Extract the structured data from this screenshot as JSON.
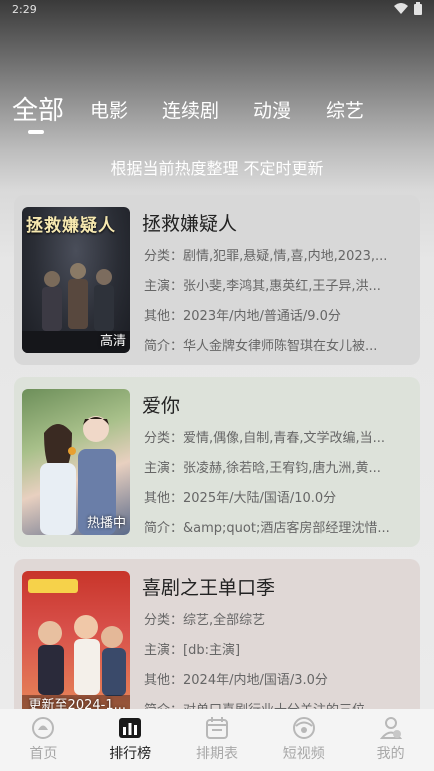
{
  "status": {
    "time": "2:29"
  },
  "tabs": [
    {
      "label": "全部"
    },
    {
      "label": "电影"
    },
    {
      "label": "连续剧"
    },
    {
      "label": "动漫"
    },
    {
      "label": "综艺"
    }
  ],
  "subtitle": "根据当前热度整理 不定时更新",
  "cards": [
    {
      "title": "拯救嫌疑人",
      "poster_title": "拯救嫌疑人",
      "badge": "高清",
      "genre": "分类：剧情,犯罪,悬疑,情,喜,内地,2023,...",
      "cast": "主演：张小斐,李鸿其,惠英红,王子异,洪...",
      "other": "其他：2023年/内地/普通话/9.0分",
      "intro": "简介：华人金牌女律师陈智琪在女儿被..."
    },
    {
      "title": "爱你",
      "poster_title": "",
      "badge": "热播中",
      "genre": "分类：爱情,偶像,自制,青春,文学改编,当...",
      "cast": "主演：张凌赫,徐若晗,王宥钧,唐九洲,黄...",
      "other": "其他：2025年/大陆/国语/10.0分",
      "intro": "简介：&amp;quot;酒店客房部经理沈惜..."
    },
    {
      "title": "喜剧之王单口季",
      "poster_title": "",
      "badge": "更新至2024-1...",
      "genre": "分类：综艺,全部综艺",
      "cast": "主演：[db:主演]",
      "other": "其他：2024年/内地/国语/3.0分",
      "intro": "简介：对单口喜剧行业十分关注的三位..."
    }
  ],
  "nav": [
    {
      "label": "首页"
    },
    {
      "label": "排行榜"
    },
    {
      "label": "排期表"
    },
    {
      "label": "短视频"
    },
    {
      "label": "我的"
    }
  ]
}
